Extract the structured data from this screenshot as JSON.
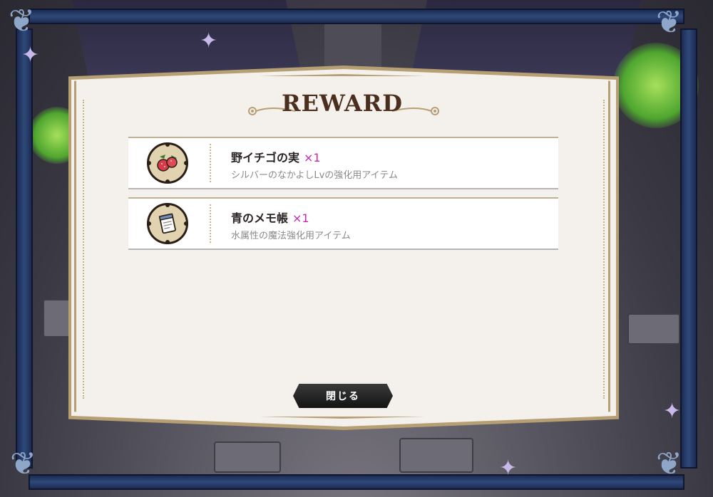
{
  "dialog": {
    "title": "REWARD",
    "close_label": "閉じる"
  },
  "rewards": [
    {
      "name": "野イチゴの実",
      "quantity": "×1",
      "description": "シルバーのなかよしLvの強化用アイテム",
      "icon": "wild-strawberry-icon"
    },
    {
      "name": "青のメモ帳",
      "quantity": "×1",
      "description": "水属性の魔法強化用アイテム",
      "icon": "blue-notepad-icon"
    }
  ],
  "colors": {
    "quantity_accent": "#c229b3",
    "panel_border": "#b79f74",
    "panel_bg": "#f4f1ec",
    "frame_blue": "#2e4a7a"
  }
}
